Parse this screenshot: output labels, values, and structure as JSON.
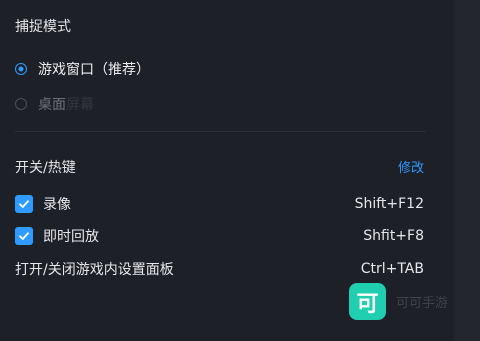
{
  "capture": {
    "title": "捕捉模式",
    "options": [
      {
        "label": "游戏窗口（推荐）",
        "checked": true
      },
      {
        "label_visible": "桌面",
        "label_faded": "屏幕",
        "checked": false
      }
    ]
  },
  "hotkeys": {
    "title": "开关/热键",
    "edit_label": "修改",
    "items": [
      {
        "label": "录像",
        "key": "Shift+F12",
        "checked": true
      },
      {
        "label": "即时回放",
        "key": "Shfit+F8",
        "checked": true
      },
      {
        "label": "打开/关闭游戏内设置面板",
        "key": "Ctrl+TAB"
      }
    ]
  },
  "watermark": {
    "logo_char": "可",
    "text": "可可手游"
  },
  "colors": {
    "accent": "#2f9bff",
    "background": "#1e2028",
    "watermark_logo": "#1fcfb0"
  }
}
